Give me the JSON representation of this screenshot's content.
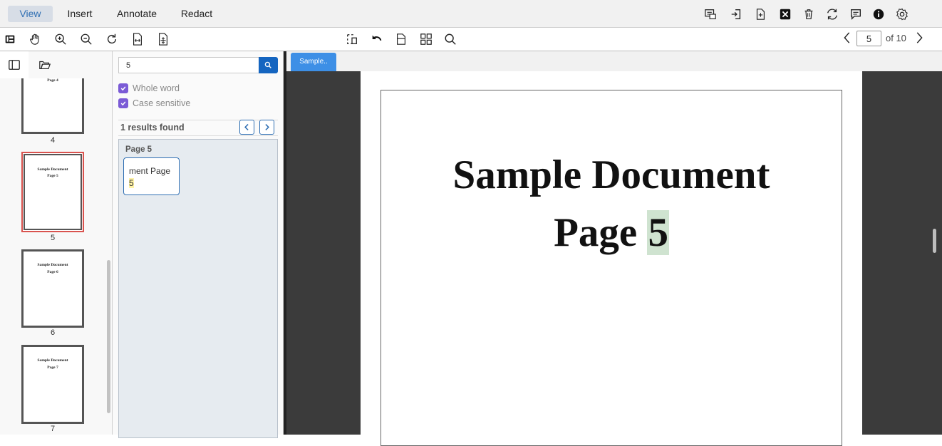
{
  "menu": {
    "tabs": [
      {
        "label": "View"
      },
      {
        "label": "Insert"
      },
      {
        "label": "Annotate"
      },
      {
        "label": "Redact"
      }
    ],
    "right_icons": [
      "comments-panel-icon",
      "import-icon",
      "new-page-icon",
      "close-doc-icon",
      "delete-icon",
      "rotate-pages-icon",
      "comment-icon",
      "info-icon",
      "settings-icon"
    ]
  },
  "toolbar": {
    "left_icons": [
      "panel-toggle-icon",
      "pan-hand-icon",
      "zoom-in-icon",
      "zoom-out-icon",
      "rotate-icon",
      "fit-width-icon",
      "fit-page-icon"
    ],
    "center_icons": [
      "select-area-icon",
      "undo-icon",
      "single-page-icon",
      "grid-view-icon",
      "search-icon"
    ],
    "page_current": "5",
    "page_total_label": "of 10"
  },
  "thumbnails": [
    {
      "title": "Page 4",
      "number": "4"
    },
    {
      "title": "Sample Document",
      "subtitle": "Page 5",
      "number": "5",
      "selected": true
    },
    {
      "title": "Sample Document",
      "subtitle": "Page 6",
      "number": "6"
    },
    {
      "title": "Sample Document",
      "subtitle": "Page 7",
      "number": "7"
    }
  ],
  "search": {
    "query": "5",
    "whole_word_label": "Whole word",
    "case_sensitive_label": "Case sensitive",
    "results_label": "1 results found",
    "result_page_label": "Page 5",
    "result_snippet_before": "ment Page",
    "result_snippet_match": "5"
  },
  "document": {
    "tab_label": "Sample..",
    "title": "Sample Document",
    "page_prefix": "Page",
    "page_match": "5"
  },
  "colors": {
    "accent": "#2f6fb3",
    "search_button": "#1565c0",
    "checkbox": "#7b5bd6",
    "selected_thumb_border": "#d9534f",
    "highlight": "#cfe3d0",
    "viewer_bg": "#3b3b3b"
  }
}
